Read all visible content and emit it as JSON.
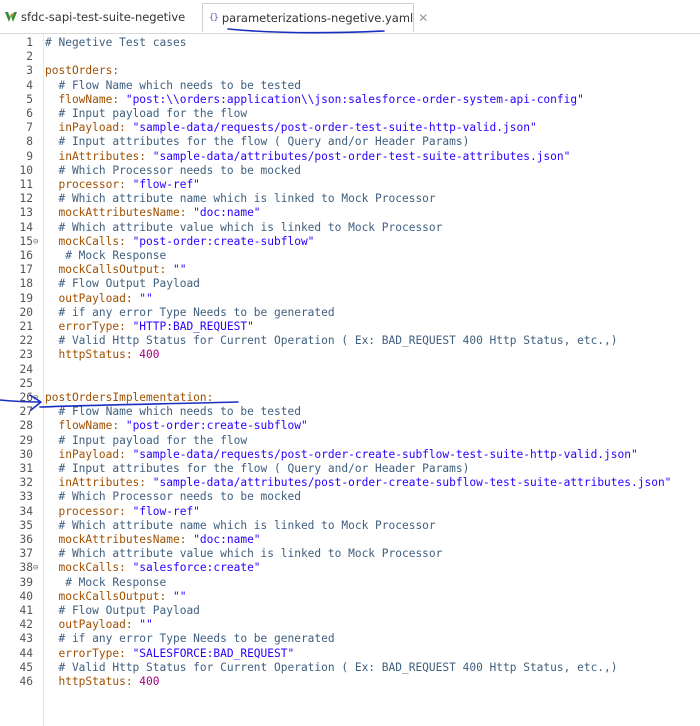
{
  "tabs": [
    {
      "label": "sfdc-sapi-test-suite-negetive",
      "icon": "mule-icon"
    },
    {
      "label": "parameterizations-negetive.yaml",
      "icon": "yaml-icon"
    }
  ],
  "tab_close_glyph": "✕",
  "tab2_icon_text": "{}",
  "lines": [
    {
      "n": "1",
      "t": [
        [
          "c",
          "# Negetive Test cases"
        ]
      ]
    },
    {
      "n": "2",
      "t": []
    },
    {
      "n": "3",
      "t": [
        [
          "k",
          "postOrders:"
        ]
      ]
    },
    {
      "n": "4",
      "t": [
        [
          "c",
          "  # Flow Name which needs to be tested"
        ]
      ]
    },
    {
      "n": "5",
      "t": [
        [
          "k",
          "  flowName: "
        ],
        [
          "v",
          "\"post:\\\\orders:application\\\\json:salesforce-order-system-api-config\""
        ]
      ]
    },
    {
      "n": "6",
      "t": [
        [
          "c",
          "  # Input payload for the flow"
        ]
      ]
    },
    {
      "n": "7",
      "t": [
        [
          "k",
          "  inPayload: "
        ],
        [
          "v",
          "\"sample-data/requests/post-order-test-suite-http-valid.json\""
        ]
      ]
    },
    {
      "n": "8",
      "t": [
        [
          "c",
          "  # Input attributes for the flow ( Query and/or Header Params)"
        ]
      ]
    },
    {
      "n": "9",
      "t": [
        [
          "k",
          "  inAttributes: "
        ],
        [
          "v",
          "\"sample-data/attributes/post-order-test-suite-attributes.json\""
        ]
      ]
    },
    {
      "n": "10",
      "t": [
        [
          "c",
          "  # Which Processor needs to be mocked"
        ]
      ]
    },
    {
      "n": "11",
      "t": [
        [
          "k",
          "  processor: "
        ],
        [
          "v",
          "\"flow-ref\""
        ]
      ]
    },
    {
      "n": "12",
      "t": [
        [
          "c",
          "  # Which attribute name which is linked to Mock Processor"
        ]
      ]
    },
    {
      "n": "13",
      "t": [
        [
          "k",
          "  mockAttributesName: "
        ],
        [
          "v",
          "\"doc:name\""
        ]
      ]
    },
    {
      "n": "14",
      "t": [
        [
          "c",
          "  # Which attribute value which is linked to Mock Processor"
        ]
      ]
    },
    {
      "n": "15",
      "fold": "⊖",
      "t": [
        [
          "k",
          "  mockCalls: "
        ],
        [
          "v",
          "\"post-order:create-subflow\""
        ]
      ]
    },
    {
      "n": "16",
      "t": [
        [
          "c",
          "   # Mock Response"
        ]
      ]
    },
    {
      "n": "17",
      "t": [
        [
          "k",
          "  mockCallsOutput: "
        ],
        [
          "v",
          "\"\""
        ]
      ]
    },
    {
      "n": "18",
      "t": [
        [
          "c",
          "  # Flow Output Payload"
        ]
      ]
    },
    {
      "n": "19",
      "t": [
        [
          "k",
          "  outPayload: "
        ],
        [
          "v",
          "\"\""
        ]
      ]
    },
    {
      "n": "20",
      "t": [
        [
          "c",
          "  # if any error Type Needs to be generated"
        ]
      ]
    },
    {
      "n": "21",
      "t": [
        [
          "k",
          "  errorType: "
        ],
        [
          "v",
          "\"HTTP:BAD_REQUEST\""
        ]
      ]
    },
    {
      "n": "22",
      "t": [
        [
          "c",
          "  # Valid Http Status for Current Operation ( Ex: BAD_REQUEST 400 Http Status, etc.,)"
        ]
      ]
    },
    {
      "n": "23",
      "t": [
        [
          "k",
          "  httpStatus: "
        ],
        [
          "n",
          "400"
        ]
      ]
    },
    {
      "n": "24",
      "t": []
    },
    {
      "n": "25",
      "t": []
    },
    {
      "n": "26",
      "fold": "⊖",
      "t": [
        [
          "k",
          "postOrdersImplementation:"
        ]
      ]
    },
    {
      "n": "27",
      "t": [
        [
          "c",
          "  # Flow Name which needs to be tested"
        ]
      ]
    },
    {
      "n": "28",
      "t": [
        [
          "k",
          "  flowName: "
        ],
        [
          "v",
          "\"post-order:create-subflow\""
        ]
      ]
    },
    {
      "n": "29",
      "t": [
        [
          "c",
          "  # Input payload for the flow"
        ]
      ]
    },
    {
      "n": "30",
      "t": [
        [
          "k",
          "  inPayload: "
        ],
        [
          "v",
          "\"sample-data/requests/post-order-create-subflow-test-suite-http-valid.json\""
        ]
      ]
    },
    {
      "n": "31",
      "t": [
        [
          "c",
          "  # Input attributes for the flow ( Query and/or Header Params)"
        ]
      ]
    },
    {
      "n": "32",
      "t": [
        [
          "k",
          "  inAttributes: "
        ],
        [
          "v",
          "\"sample-data/attributes/post-order-create-subflow-test-suite-attributes.json\""
        ]
      ]
    },
    {
      "n": "33",
      "t": [
        [
          "c",
          "  # Which Processor needs to be mocked"
        ]
      ]
    },
    {
      "n": "34",
      "t": [
        [
          "k",
          "  processor: "
        ],
        [
          "v",
          "\"flow-ref\""
        ]
      ]
    },
    {
      "n": "35",
      "t": [
        [
          "c",
          "  # Which attribute name which is linked to Mock Processor"
        ]
      ]
    },
    {
      "n": "36",
      "t": [
        [
          "k",
          "  mockAttributesName: "
        ],
        [
          "v",
          "\"doc:name\""
        ]
      ]
    },
    {
      "n": "37",
      "t": [
        [
          "c",
          "  # Which attribute value which is linked to Mock Processor"
        ]
      ]
    },
    {
      "n": "38",
      "fold": "⊖",
      "t": [
        [
          "k",
          "  mockCalls: "
        ],
        [
          "v",
          "\"salesforce:create\""
        ]
      ]
    },
    {
      "n": "39",
      "t": [
        [
          "c",
          "   # Mock Response"
        ]
      ]
    },
    {
      "n": "40",
      "t": [
        [
          "k",
          "  mockCallsOutput: "
        ],
        [
          "v",
          "\"\""
        ]
      ]
    },
    {
      "n": "41",
      "t": [
        [
          "c",
          "  # Flow Output Payload"
        ]
      ]
    },
    {
      "n": "42",
      "t": [
        [
          "k",
          "  outPayload: "
        ],
        [
          "v",
          "\"\""
        ]
      ]
    },
    {
      "n": "43",
      "t": [
        [
          "c",
          "  # if any error Type Needs to be generated"
        ]
      ]
    },
    {
      "n": "44",
      "t": [
        [
          "k",
          "  errorType: "
        ],
        [
          "v",
          "\"SALESFORCE:BAD_REQUEST\""
        ]
      ]
    },
    {
      "n": "45",
      "t": [
        [
          "c",
          "  # Valid Http Status for Current Operation ( Ex: BAD_REQUEST 400 Http Status, etc.,)"
        ]
      ]
    },
    {
      "n": "46",
      "t": [
        [
          "k",
          "  httpStatus: "
        ],
        [
          "n",
          "400"
        ]
      ]
    }
  ],
  "colors": {
    "key": "#a05000",
    "string": "#2a00ff",
    "comment": "#3f5f7f",
    "number": "#a0007f",
    "annotation_ink": "#1a2fbf"
  }
}
